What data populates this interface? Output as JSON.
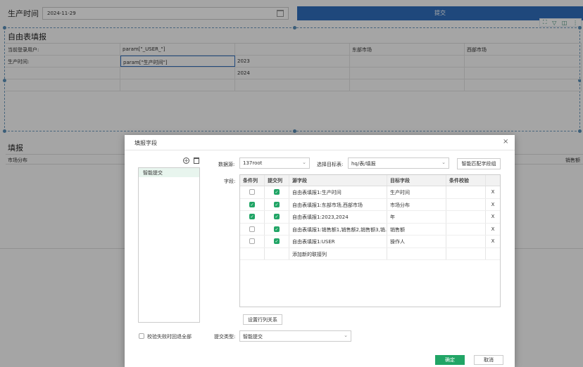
{
  "top": {
    "prod_label": "生产时间",
    "date_value": "2024-11-29",
    "submit_label": "提交",
    "toolbar_icons": [
      "expand-icon",
      "filter-icon",
      "split-icon",
      "more-icon"
    ]
  },
  "sheet1": {
    "title": "自由表填报",
    "rows": [
      [
        "当前登录用户:",
        "param[\"_USER_\"]",
        "",
        "东部市场",
        "西部市场"
      ],
      [
        "生产时间:",
        "param[\"生产时间\"]",
        "2023",
        "",
        ""
      ],
      [
        "",
        "",
        "2024",
        "",
        ""
      ],
      [
        "",
        "",
        "",
        "",
        ""
      ]
    ]
  },
  "sheet2": {
    "title": "填报",
    "header_left": "市场分布",
    "header_right": "销售额"
  },
  "dialog": {
    "title": "填报字段",
    "close": "×",
    "left_items": [
      "智能提交"
    ],
    "datasource_label": "数据源:",
    "datasource_value": "137root",
    "target_label": "选择目标表:",
    "target_value": "hq/表/填报",
    "match_button": "智能匹配字段组",
    "field_label": "字段:",
    "columns": [
      "条件列",
      "提交列",
      "源字段",
      "目标字段",
      "条件校验",
      ""
    ],
    "rows": [
      {
        "cond": false,
        "submit": true,
        "source": "自由表填报1:生产时间",
        "target": "生产时间",
        "check": "",
        "del": "X"
      },
      {
        "cond": true,
        "submit": true,
        "source": "自由表填报1:东部市场,西部市场",
        "target": "市场分布",
        "check": "",
        "del": "X"
      },
      {
        "cond": true,
        "submit": true,
        "source": "自由表填报1:2023,2024",
        "target": "年",
        "check": "",
        "del": "X"
      },
      {
        "cond": false,
        "submit": true,
        "source": "自由表填报1:销售额1,销售额2,销售额3,销...",
        "target": "销售额",
        "check": "",
        "del": "X"
      },
      {
        "cond": false,
        "submit": true,
        "source": "自由表填报1:USER",
        "target": "操作人",
        "check": "",
        "del": "X"
      }
    ],
    "add_row_label": "添加新的联接列",
    "set_relation_button": "设置行列关系",
    "rollback_label": "校验失败时回退全部",
    "submit_type_label": "提交类型:",
    "submit_type_value": "智能提交",
    "ok": "确定",
    "cancel": "取消"
  },
  "colors": {
    "accent": "#21a566",
    "submit": "#2f6ebd"
  }
}
